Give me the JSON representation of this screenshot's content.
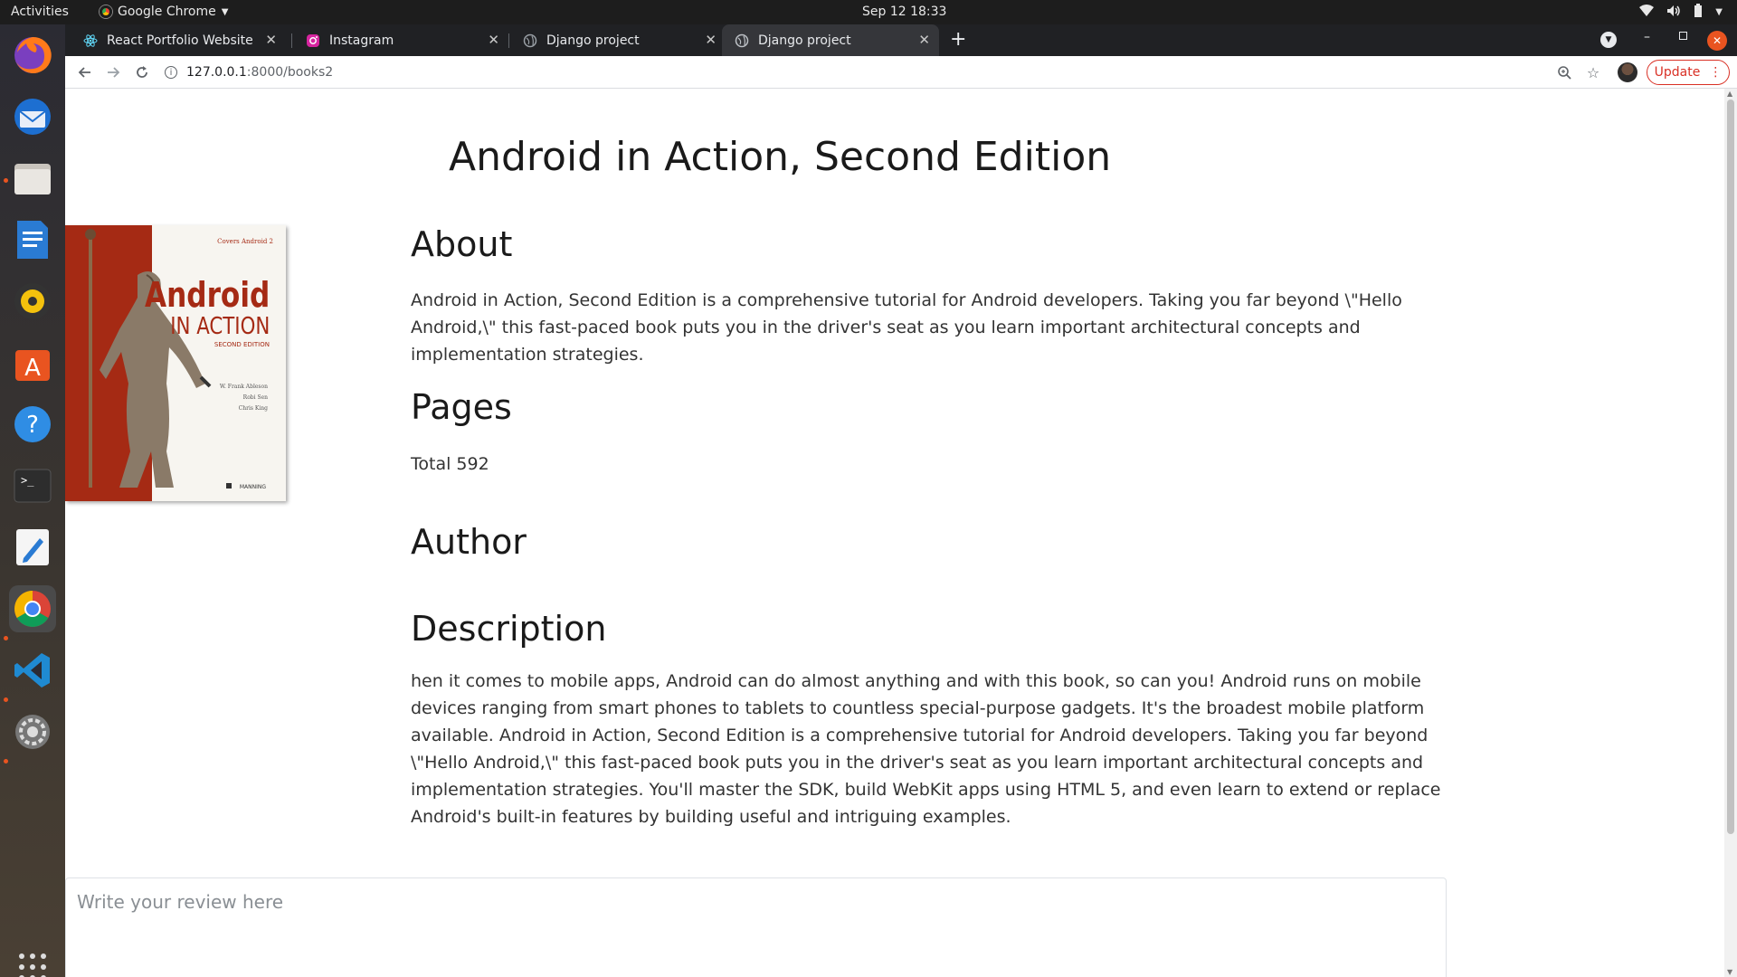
{
  "topbar": {
    "activities": "Activities",
    "app_name": "Google Chrome",
    "clock": "Sep 12  18:33"
  },
  "tabs": [
    {
      "label": "React Portfolio Website",
      "icon": "react-icon"
    },
    {
      "label": "Instagram",
      "icon": "instagram-icon"
    },
    {
      "label": "Django project",
      "icon": "globe-icon"
    },
    {
      "label": "Django project",
      "icon": "globe-icon",
      "active": true
    }
  ],
  "toolbar": {
    "url_host": "127.0.0.1",
    "url_rest": ":8000/books2",
    "update_label": "Update"
  },
  "book": {
    "title": "Android in Action, Second Edition",
    "about_heading": "About",
    "about_text": "Android in Action, Second Edition is a comprehensive tutorial for Android developers. Taking you far beyond \\\"Hello Android,\\\" this fast-paced book puts you in the driver's seat as you learn important architectural concepts and implementation strategies.",
    "pages_heading": "Pages",
    "pages_text": "Total 592",
    "author_heading": "Author",
    "description_heading": "Description",
    "description_text": "hen it comes to mobile apps, Android can do almost anything and with this book, so can you! Android runs on mobile devices ranging from smart phones to tablets to countless special-purpose gadgets. It's the broadest mobile platform available. Android in Action, Second Edition is a comprehensive tutorial for Android developers. Taking you far beyond \\\"Hello Android,\\\" this fast-paced book puts you in the driver's seat as you learn important architectural concepts and implementation strategies. You'll master the SDK, build WebKit apps using HTML 5, and even learn to extend or replace Android's built-in features by building useful and intriguing examples.",
    "cover": {
      "top_text": "Covers Android 2",
      "title_line1": "Android",
      "title_line2": "IN ACTION",
      "edition": "SECOND EDITION",
      "authors": [
        "W. Frank Ableson",
        "Robi Sen",
        "Chris King"
      ],
      "publisher": "MANNING",
      "colors": {
        "red": "#a52a14",
        "paper": "#f7f5f0"
      }
    }
  },
  "review": {
    "placeholder": "Write your review here"
  },
  "colors": {
    "accent_update": "#d93025",
    "tabstrip": "#202124",
    "active_tab": "#35363a"
  }
}
